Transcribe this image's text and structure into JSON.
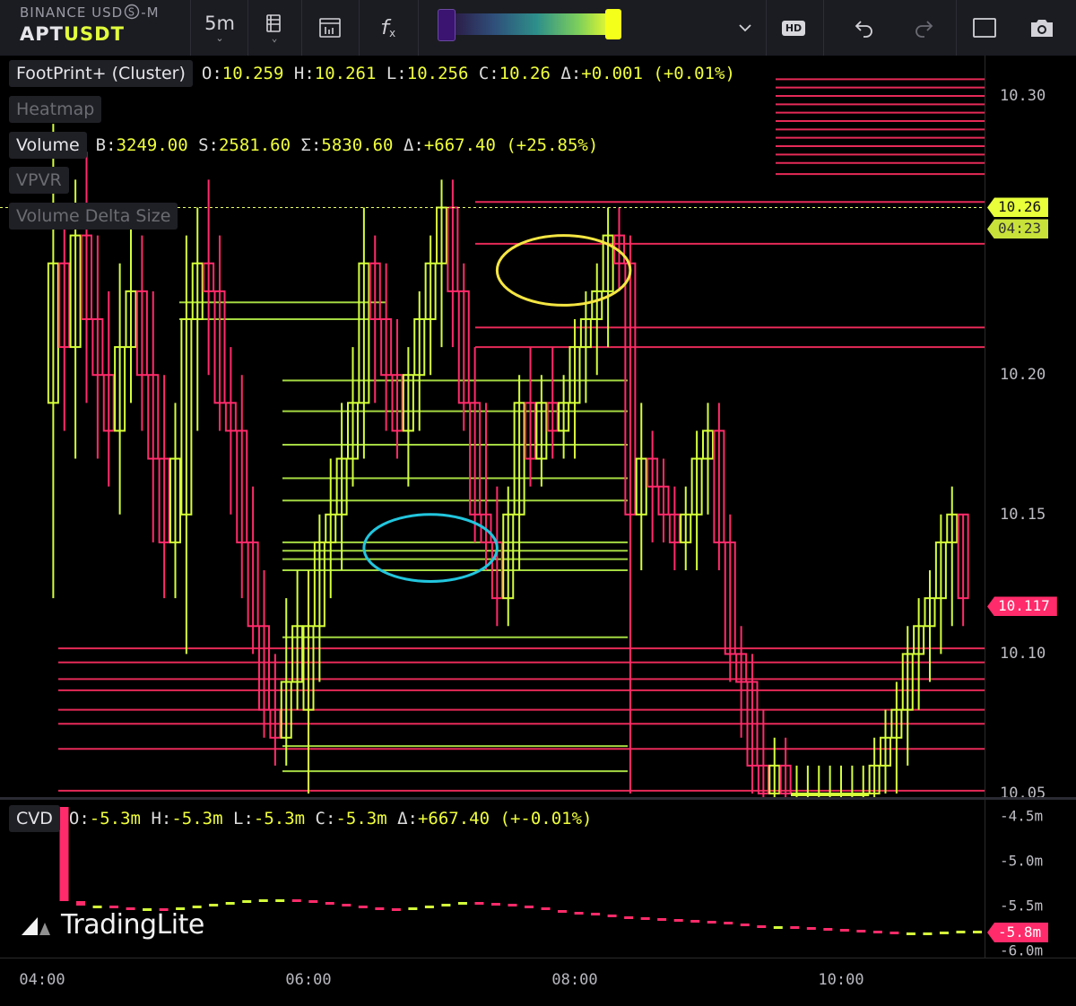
{
  "toolbar": {
    "exchange": "BINANCE USD",
    "exchange_suffix": "-M",
    "symbol_base": "APT",
    "symbol_quote": "USDT",
    "timeframe": "5m",
    "icons": [
      "indicators-icon",
      "layout-icon",
      "formula-icon",
      "heatmap-range-slider",
      "chevron-down-icon",
      "hd-icon",
      "undo-icon",
      "redo-icon",
      "fullscreen-icon",
      "camera-icon"
    ],
    "hd_label": "HD"
  },
  "legend": {
    "footprint": {
      "name": "FootPrint+ (Cluster)",
      "o_label": "O:",
      "o": "10.259",
      "h_label": "H:",
      "h": "10.261",
      "l_label": "L:",
      "l": "10.256",
      "c_label": "C:",
      "c": "10.26",
      "d_label": "Δ:",
      "d": "+0.001",
      "pct": "(+0.01%)"
    },
    "heatmap": {
      "name": "Heatmap"
    },
    "volume": {
      "name": "Volume",
      "b_label": "B:",
      "b": "3249.00",
      "s_label": "S:",
      "s": "2581.60",
      "sum_label": "Σ:",
      "sum": "5830.60",
      "d_label": "Δ:",
      "d": "+667.40",
      "pct": "(+25.85%)"
    },
    "vpvr": {
      "name": "VPVR"
    },
    "vds": {
      "name": "Volume Delta Size"
    },
    "cvd": {
      "name": "CVD",
      "o_label": "O:",
      "o": "-5.3m",
      "h_label": "H:",
      "h": "-5.3m",
      "l_label": "L:",
      "l": "-5.3m",
      "c_label": "C:",
      "c": "-5.3m",
      "d_label": "Δ:",
      "d": "+667.40",
      "pct": "(+-0.01%)"
    }
  },
  "price_axis": {
    "ticks": [
      10.3,
      10.2,
      10.15,
      10.1,
      10.05
    ],
    "tick_labels": [
      "10.30",
      "10.20",
      "10.15",
      "10.10",
      "10.05"
    ],
    "current_price": "10.26",
    "countdown": "04:23",
    "marker_price": "10.117"
  },
  "cvd_axis": {
    "tick_labels": [
      "-4.5m",
      "-5.0m",
      "-5.5m",
      "-6.0m"
    ],
    "current": "-5.8m"
  },
  "time_axis": {
    "labels": [
      "04:00",
      "06:00",
      "08:00",
      "10:00"
    ]
  },
  "branding": {
    "name": "TradingLite"
  },
  "colors": {
    "up": "#d4ff3a",
    "down": "#ff2b6a",
    "up_level": "#b6f04a",
    "down_level": "#ff2f62",
    "annot_yellow": "#f5e642",
    "annot_cyan": "#22c6de"
  },
  "chart_data": {
    "type": "candlestick",
    "interval": "5m",
    "x_range": [
      "04:00",
      "11:00"
    ],
    "ylim": [
      10.05,
      10.31
    ],
    "series": [
      {
        "name": "APTUSDT",
        "ohlc": [
          [
            "04:05",
            10.19,
            10.29,
            10.12,
            10.24
          ],
          [
            "04:10",
            10.24,
            10.26,
            10.18,
            10.21
          ],
          [
            "04:15",
            10.21,
            10.27,
            10.17,
            10.25
          ],
          [
            "04:20",
            10.25,
            10.28,
            10.19,
            10.22
          ],
          [
            "04:25",
            10.22,
            10.25,
            10.17,
            10.2
          ],
          [
            "04:30",
            10.2,
            10.23,
            10.16,
            10.18
          ],
          [
            "04:35",
            10.18,
            10.24,
            10.15,
            10.21
          ],
          [
            "04:40",
            10.21,
            10.26,
            10.19,
            10.23
          ],
          [
            "04:45",
            10.23,
            10.25,
            10.18,
            10.2
          ],
          [
            "04:50",
            10.2,
            10.23,
            10.14,
            10.17
          ],
          [
            "04:55",
            10.17,
            10.2,
            10.12,
            10.14
          ],
          [
            "05:00",
            10.14,
            10.19,
            10.12,
            10.17
          ],
          [
            "05:05",
            10.15,
            10.25,
            10.1,
            10.22
          ],
          [
            "05:10",
            10.22,
            10.26,
            10.18,
            10.24
          ],
          [
            "05:15",
            10.24,
            10.27,
            10.2,
            10.23
          ],
          [
            "05:20",
            10.23,
            10.25,
            10.18,
            10.19
          ],
          [
            "05:25",
            10.19,
            10.21,
            10.15,
            10.18
          ],
          [
            "05:30",
            10.18,
            10.2,
            10.12,
            10.14
          ],
          [
            "05:35",
            10.14,
            10.16,
            10.1,
            10.11
          ],
          [
            "05:40",
            10.11,
            10.13,
            10.07,
            10.08
          ],
          [
            "05:45",
            10.08,
            10.1,
            10.06,
            10.07
          ],
          [
            "05:50",
            10.07,
            10.12,
            10.06,
            10.09
          ],
          [
            "05:55",
            10.09,
            10.13,
            10.08,
            10.11
          ],
          [
            "06:00",
            10.08,
            10.13,
            10.05,
            10.11
          ],
          [
            "06:05",
            10.11,
            10.15,
            10.09,
            10.14
          ],
          [
            "06:10",
            10.14,
            10.17,
            10.12,
            10.15
          ],
          [
            "06:15",
            10.15,
            10.19,
            10.13,
            10.17
          ],
          [
            "06:20",
            10.17,
            10.21,
            10.16,
            10.19
          ],
          [
            "06:25",
            10.19,
            10.26,
            10.17,
            10.24
          ],
          [
            "06:30",
            10.24,
            10.25,
            10.19,
            10.22
          ],
          [
            "06:35",
            10.22,
            10.24,
            10.18,
            10.2
          ],
          [
            "06:40",
            10.2,
            10.22,
            10.17,
            10.18
          ],
          [
            "06:45",
            10.18,
            10.21,
            10.16,
            10.2
          ],
          [
            "06:50",
            10.2,
            10.23,
            10.18,
            10.22
          ],
          [
            "06:55",
            10.22,
            10.25,
            10.2,
            10.24
          ],
          [
            "07:00",
            10.24,
            10.27,
            10.21,
            10.26
          ],
          [
            "07:05",
            10.26,
            10.27,
            10.21,
            10.23
          ],
          [
            "07:10",
            10.23,
            10.24,
            10.18,
            10.19
          ],
          [
            "07:15",
            10.19,
            10.21,
            10.14,
            10.15
          ],
          [
            "07:20",
            10.15,
            10.19,
            10.13,
            10.14
          ],
          [
            "07:25",
            10.14,
            10.16,
            10.11,
            10.12
          ],
          [
            "07:30",
            10.12,
            10.16,
            10.11,
            10.15
          ],
          [
            "07:35",
            10.15,
            10.2,
            10.13,
            10.19
          ],
          [
            "07:40",
            10.19,
            10.21,
            10.16,
            10.17
          ],
          [
            "07:45",
            10.17,
            10.2,
            10.16,
            10.19
          ],
          [
            "07:50",
            10.19,
            10.21,
            10.17,
            10.18
          ],
          [
            "07:55",
            10.18,
            10.2,
            10.17,
            10.19
          ],
          [
            "08:00",
            10.19,
            10.22,
            10.17,
            10.21
          ],
          [
            "08:05",
            10.21,
            10.23,
            10.19,
            10.22
          ],
          [
            "08:10",
            10.22,
            10.24,
            10.2,
            10.23
          ],
          [
            "08:15",
            10.23,
            10.26,
            10.21,
            10.25
          ],
          [
            "08:20",
            10.25,
            10.26,
            10.23,
            10.24
          ],
          [
            "08:25",
            10.24,
            10.25,
            10.05,
            10.15
          ],
          [
            "08:30",
            10.15,
            10.19,
            10.13,
            10.17
          ],
          [
            "08:35",
            10.17,
            10.18,
            10.14,
            10.16
          ],
          [
            "08:40",
            10.16,
            10.17,
            10.14,
            10.15
          ],
          [
            "08:45",
            10.15,
            10.16,
            10.13,
            10.14
          ],
          [
            "08:50",
            10.14,
            10.16,
            10.13,
            10.15
          ],
          [
            "08:55",
            10.15,
            10.18,
            10.13,
            10.17
          ],
          [
            "09:00",
            10.17,
            10.19,
            10.15,
            10.18
          ],
          [
            "09:05",
            10.18,
            10.19,
            10.13,
            10.14
          ],
          [
            "09:10",
            10.14,
            10.15,
            10.09,
            10.1
          ],
          [
            "09:15",
            10.1,
            10.11,
            10.07,
            10.09
          ],
          [
            "09:20",
            10.09,
            10.1,
            10.05,
            10.06
          ],
          [
            "09:25",
            10.06,
            10.08,
            10.04,
            10.05
          ],
          [
            "09:30",
            10.05,
            10.07,
            10.04,
            10.06
          ],
          [
            "09:35",
            10.06,
            10.07,
            10.04,
            10.05
          ],
          [
            "09:40",
            10.05,
            10.06,
            10.04,
            10.05
          ],
          [
            "09:45",
            10.05,
            10.06,
            10.04,
            10.05
          ],
          [
            "09:50",
            10.05,
            10.06,
            10.04,
            10.05
          ],
          [
            "09:55",
            10.05,
            10.06,
            10.04,
            10.05
          ],
          [
            "10:00",
            10.05,
            10.06,
            10.04,
            10.05
          ],
          [
            "10:05",
            10.05,
            10.06,
            10.04,
            10.05
          ],
          [
            "10:10",
            10.05,
            10.06,
            10.04,
            10.05
          ],
          [
            "10:15",
            10.05,
            10.07,
            10.04,
            10.06
          ],
          [
            "10:20",
            10.06,
            10.08,
            10.05,
            10.07
          ],
          [
            "10:25",
            10.07,
            10.09,
            10.05,
            10.08
          ],
          [
            "10:30",
            10.08,
            10.11,
            10.06,
            10.1
          ],
          [
            "10:35",
            10.1,
            10.12,
            10.08,
            10.11
          ],
          [
            "10:40",
            10.11,
            10.13,
            10.09,
            10.12
          ],
          [
            "10:45",
            10.12,
            10.15,
            10.1,
            10.14
          ],
          [
            "10:50",
            10.14,
            10.16,
            10.11,
            10.15
          ],
          [
            "10:55",
            10.15,
            10.15,
            10.11,
            10.12
          ]
        ]
      }
    ],
    "levels": [
      {
        "price": 10.306,
        "side": "sell"
      },
      {
        "price": 10.303,
        "side": "sell"
      },
      {
        "price": 10.3,
        "side": "sell"
      },
      {
        "price": 10.297,
        "side": "sell"
      },
      {
        "price": 10.294,
        "side": "sell"
      },
      {
        "price": 10.291,
        "side": "sell"
      },
      {
        "price": 10.288,
        "side": "sell"
      },
      {
        "price": 10.285,
        "side": "sell"
      },
      {
        "price": 10.282,
        "side": "sell"
      },
      {
        "price": 10.279,
        "side": "sell"
      },
      {
        "price": 10.276,
        "side": "sell"
      },
      {
        "price": 10.272,
        "side": "sell"
      },
      {
        "price": 10.262,
        "side": "sell"
      },
      {
        "price": 10.247,
        "side": "sell"
      },
      {
        "price": 10.217,
        "side": "sell"
      },
      {
        "price": 10.21,
        "side": "sell"
      },
      {
        "price": 10.102,
        "side": "sell"
      },
      {
        "price": 10.097,
        "side": "sell"
      },
      {
        "price": 10.091,
        "side": "sell"
      },
      {
        "price": 10.087,
        "side": "sell"
      },
      {
        "price": 10.08,
        "side": "sell"
      },
      {
        "price": 10.075,
        "side": "sell"
      },
      {
        "price": 10.066,
        "side": "sell"
      },
      {
        "price": 10.051,
        "side": "sell"
      },
      {
        "price": 10.14,
        "side": "buy"
      },
      {
        "price": 10.137,
        "side": "buy"
      },
      {
        "price": 10.134,
        "side": "buy"
      },
      {
        "price": 10.13,
        "side": "buy"
      },
      {
        "price": 10.155,
        "side": "buy"
      },
      {
        "price": 10.106,
        "side": "buy"
      },
      {
        "price": 10.163,
        "side": "buy"
      },
      {
        "price": 10.198,
        "side": "buy"
      },
      {
        "price": 10.187,
        "side": "buy"
      },
      {
        "price": 10.175,
        "side": "buy"
      },
      {
        "price": 10.22,
        "side": "buy"
      },
      {
        "price": 10.226,
        "side": "buy"
      },
      {
        "price": 10.067,
        "side": "buy"
      },
      {
        "price": 10.058,
        "side": "buy"
      }
    ],
    "annotations": [
      {
        "shape": "ellipse",
        "color": "yellow",
        "price_range": [
          10.225,
          10.25
        ],
        "time_range": [
          "07:25",
          "08:25"
        ]
      },
      {
        "shape": "ellipse",
        "color": "cyan",
        "price_range": [
          10.126,
          10.15
        ],
        "time_range": [
          "06:25",
          "07:25"
        ]
      }
    ]
  },
  "cvd_data": {
    "type": "line",
    "ylim": [
      -6.05,
      -4.35
    ],
    "values": [
      -4.4,
      -5.45,
      -5.5,
      -5.5,
      -5.52,
      -5.53,
      -5.53,
      -5.54,
      -5.52,
      -5.5,
      -5.48,
      -5.46,
      -5.44,
      -5.43,
      -5.43,
      -5.44,
      -5.46,
      -5.48,
      -5.5,
      -5.52,
      -5.53,
      -5.54,
      -5.52,
      -5.5,
      -5.48,
      -5.46,
      -5.47,
      -5.48,
      -5.5,
      -5.52,
      -5.55,
      -5.57,
      -5.58,
      -5.6,
      -5.62,
      -5.63,
      -5.64,
      -5.65,
      -5.66,
      -5.67,
      -5.68,
      -5.7,
      -5.72,
      -5.73,
      -5.73,
      -5.74,
      -5.75,
      -5.76,
      -5.77,
      -5.78,
      -5.79,
      -5.8,
      -5.8,
      -5.8,
      -5.79,
      -5.78,
      -5.78
    ]
  }
}
